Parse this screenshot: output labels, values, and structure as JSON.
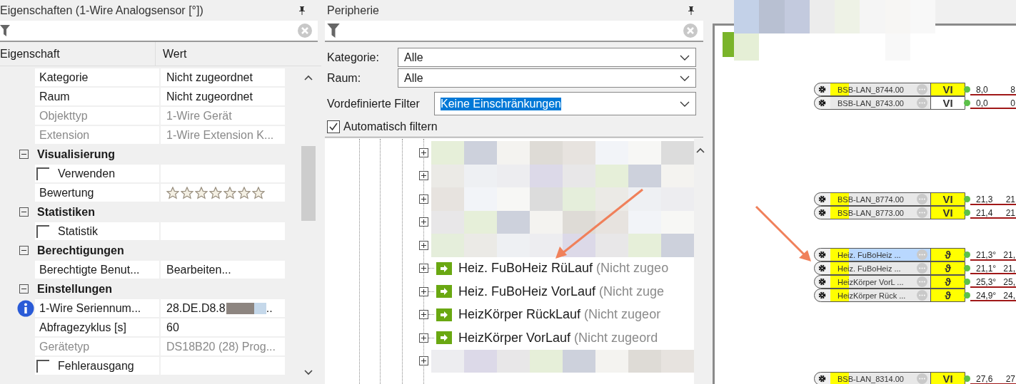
{
  "properties_panel": {
    "title": "Eigenschaften (1-Wire Analogsensor [°])",
    "columns": [
      "Eigenschaft",
      "Wert"
    ],
    "rows": [
      {
        "kind": "property",
        "label": "Kategorie",
        "value": "Nicht zugeordnet",
        "disabled": false
      },
      {
        "kind": "property",
        "label": "Raum",
        "value": "Nicht zugeordnet",
        "disabled": false
      },
      {
        "kind": "property",
        "label": "Objekttyp",
        "value": "1-Wire Gerät",
        "disabled": true
      },
      {
        "kind": "property",
        "label": "Extension",
        "value": "1-Wire Extension K...",
        "disabled": true
      },
      {
        "kind": "section",
        "label": "Visualisierung",
        "expanded": true
      },
      {
        "kind": "checkbox",
        "label": "Verwenden",
        "checked": false
      },
      {
        "kind": "rating",
        "label": "Bewertung",
        "stars": 0
      },
      {
        "kind": "section",
        "label": "Statistiken",
        "expanded": true
      },
      {
        "kind": "checkbox",
        "label": "Statistik",
        "checked": false
      },
      {
        "kind": "section",
        "label": "Berechtigungen",
        "expanded": true
      },
      {
        "kind": "property",
        "label": "Berechtigte Benut...",
        "value": "Bearbeiten...",
        "disabled": false
      },
      {
        "kind": "section",
        "label": "Einstellungen",
        "expanded": true
      },
      {
        "kind": "serial",
        "label": "1-Wire Seriennum...",
        "value": "28.DE.D8.8",
        "value_end": ".."
      },
      {
        "kind": "property",
        "label": "Abfragezyklus [s]",
        "value": "60",
        "disabled": false
      },
      {
        "kind": "property",
        "label": "Gerätetyp",
        "value": "DS18B20 (28) Prog...",
        "disabled": true
      },
      {
        "kind": "checkbox",
        "label": "Fehlerausgang",
        "checked": false
      }
    ]
  },
  "peripherals_panel": {
    "title": "Peripherie",
    "filters": [
      {
        "label": "Kategorie:",
        "value": "Alle",
        "text_selected": false
      },
      {
        "label": "Raum:",
        "value": "Alle",
        "text_selected": false
      },
      {
        "label": "Vordefinierte Filter",
        "value": "Keine Einschränkungen",
        "text_selected": true
      }
    ],
    "auto_filter": {
      "label": "Automatisch filtern",
      "checked": true
    },
    "tree": [
      {
        "kind": "redacted"
      },
      {
        "kind": "redacted"
      },
      {
        "kind": "redacted"
      },
      {
        "kind": "redacted"
      },
      {
        "kind": "redacted"
      },
      {
        "kind": "device",
        "name": "Heiz. FuBoHeiz RüLauf",
        "note": "(Nicht zugeo"
      },
      {
        "kind": "device",
        "name": "Heiz. FuBoHeiz VorLauf",
        "note": "(Nicht zuge"
      },
      {
        "kind": "device",
        "name": "HeizKörper RückLauf",
        "note": "(Nicht zugeor"
      },
      {
        "kind": "device",
        "name": "HeizKörper VorLauf",
        "note": "(Nicht zugeord"
      },
      {
        "kind": "redacted"
      }
    ]
  },
  "canvas": {
    "groups": [
      {
        "nodes": [
          {
            "name": "BSB-LAN_8744.00",
            "type": "VI",
            "highlighted": true,
            "selected": false,
            "value": "8,0",
            "value_2": "8"
          },
          {
            "name": "BSB-LAN_8743.00",
            "type": "VI",
            "highlighted": false,
            "selected": false,
            "value": "0,0",
            "value_2": "0"
          }
        ]
      },
      {
        "nodes": [
          {
            "name": "BSB-LAN_8774.00",
            "type": "VI",
            "highlighted": true,
            "selected": false,
            "value": "21,3",
            "value_2": "21"
          },
          {
            "name": "BSB-LAN_8773.00",
            "type": "VI",
            "highlighted": true,
            "selected": false,
            "value": "21,4",
            "value_2": "21"
          }
        ]
      },
      {
        "nodes": [
          {
            "name": "Heiz.  FuBoHeiz ...",
            "type": "ϑ",
            "highlighted": true,
            "selected": true,
            "value": "21,3°",
            "value_2": "21,"
          },
          {
            "name": "Heiz.  FuBoHeiz ...",
            "type": "ϑ",
            "highlighted": true,
            "selected": false,
            "value": "21,1°",
            "value_2": "21,"
          },
          {
            "name": "HeizKörper  VorL ...",
            "type": "ϑ",
            "highlighted": true,
            "selected": false,
            "value": "25,3°",
            "value_2": "25,"
          },
          {
            "name": "HeizKörper  Rück ...",
            "type": "ϑ",
            "highlighted": true,
            "selected": false,
            "value": "24,9°",
            "value_2": "24,"
          }
        ]
      },
      {
        "nodes": [
          {
            "name": "BSB-LAN_8314.00",
            "type": "VI",
            "highlighted": true,
            "selected": false,
            "value": "27,6",
            "value_2": "27"
          }
        ]
      }
    ]
  }
}
